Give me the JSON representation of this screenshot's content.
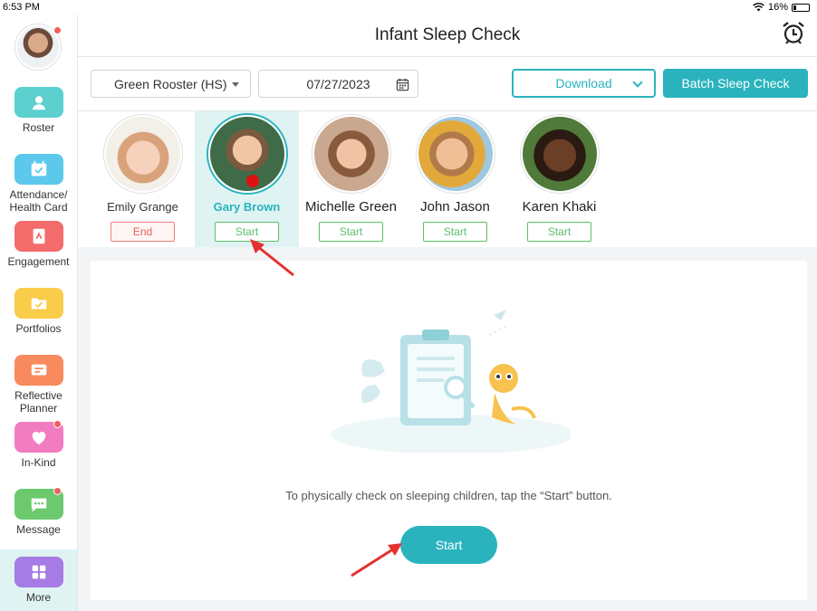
{
  "status_bar": {
    "time": "6:53 PM",
    "battery": "16%"
  },
  "sidebar": {
    "items": [
      {
        "label": "Roster",
        "icon": "roster-icon",
        "color": "#5ccfcf"
      },
      {
        "label": "Attendance/\nHealth Card",
        "icon": "calendar-check-icon",
        "color": "#5bc8ec"
      },
      {
        "label": "Engagement",
        "icon": "engagement-icon",
        "color": "#f46b6b"
      },
      {
        "label": "Portfolios",
        "icon": "portfolio-icon",
        "color": "#f9cc4a"
      },
      {
        "label": "Reflective\nPlanner",
        "icon": "planner-icon",
        "color": "#f88a5e"
      },
      {
        "label": "In-Kind",
        "icon": "heart-icon",
        "color": "#f27cc0"
      },
      {
        "label": "Message",
        "icon": "message-icon",
        "color": "#6cc96e"
      },
      {
        "label": "More",
        "icon": "more-grid-icon",
        "color": "#a57be4"
      }
    ]
  },
  "header": {
    "title": "Infant Sleep Check"
  },
  "toolbar": {
    "classroom": "Green Rooster (HS)",
    "date": "07/27/2023",
    "download_label": "Download",
    "batch_label": "Batch Sleep Check"
  },
  "children": [
    {
      "name": "Emily Grange",
      "action": "End",
      "state": "sleeping"
    },
    {
      "name": "Gary Brown",
      "action": "Start",
      "state": "selected"
    },
    {
      "name": "Michelle Green",
      "action": "Start",
      "state": "awake"
    },
    {
      "name": "John Jason",
      "action": "Start",
      "state": "awake"
    },
    {
      "name": "Karen Khaki",
      "action": "Start",
      "state": "awake"
    }
  ],
  "main": {
    "hint": "To physically check on sleeping children, tap the “Start” button.",
    "start_label": "Start"
  },
  "colors": {
    "accent": "#2ab3bd",
    "start_green": "#5cbf6a",
    "end_red": "#e9605a",
    "badge": "#f0605c"
  }
}
